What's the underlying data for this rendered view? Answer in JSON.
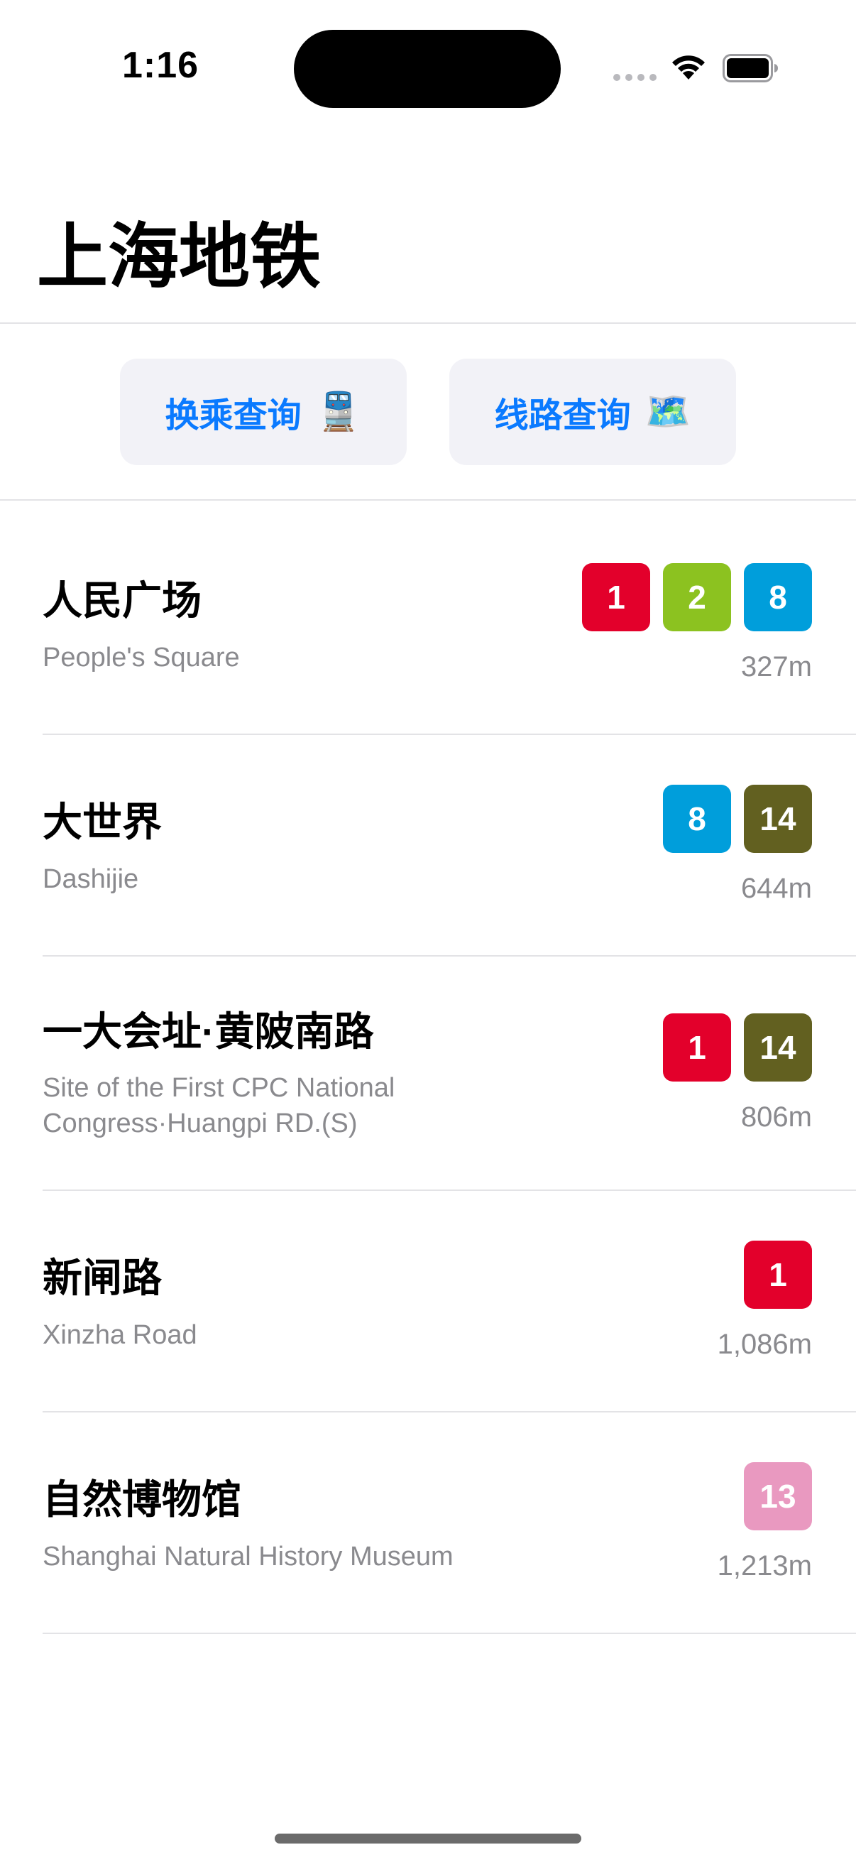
{
  "status_bar": {
    "time": "1:16"
  },
  "title": "上海地铁",
  "buttons": {
    "transfer": {
      "label": "换乘查询",
      "emoji": "🚆"
    },
    "route": {
      "label": "线路查询",
      "emoji": "🗺️"
    }
  },
  "colors": {
    "accent": "#0A7AFF",
    "line1": "#E3002B",
    "line2": "#8CC220",
    "line8": "#009EDB",
    "line13": "#E999C0",
    "line14": "#626020"
  },
  "stations": [
    {
      "name_cn": "人民广场",
      "name_en": "People's Square",
      "distance": "327m",
      "lines": [
        {
          "number": "1",
          "color": "#E3002B"
        },
        {
          "number": "2",
          "color": "#8CC220"
        },
        {
          "number": "8",
          "color": "#009EDB"
        }
      ]
    },
    {
      "name_cn": "大世界",
      "name_en": "Dashijie",
      "distance": "644m",
      "lines": [
        {
          "number": "8",
          "color": "#009EDB"
        },
        {
          "number": "14",
          "color": "#626020"
        }
      ]
    },
    {
      "name_cn": "一大会址·黄陂南路",
      "name_en": "Site of the First CPC National Congress·Huangpi RD.(S)",
      "distance": "806m",
      "lines": [
        {
          "number": "1",
          "color": "#E3002B"
        },
        {
          "number": "14",
          "color": "#626020"
        }
      ]
    },
    {
      "name_cn": "新闸路",
      "name_en": "Xinzha Road",
      "distance": "1,086m",
      "lines": [
        {
          "number": "1",
          "color": "#E3002B"
        }
      ]
    },
    {
      "name_cn": "自然博物馆",
      "name_en": "Shanghai Natural History Museum",
      "distance": "1,213m",
      "lines": [
        {
          "number": "13",
          "color": "#E999C0"
        }
      ]
    }
  ]
}
